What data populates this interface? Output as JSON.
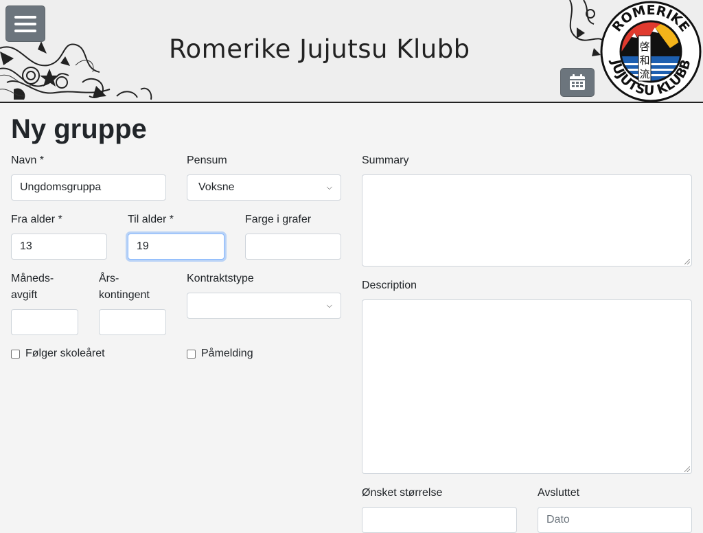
{
  "header": {
    "title": "Romerike Jujutsu Klubb",
    "logo_text_top": "ROMERIKE",
    "logo_text_bottom": "JUJUTSU KLUBB",
    "logo_kanji": [
      "啓",
      "和",
      "流"
    ],
    "menu_icon": "hamburger-icon",
    "calendar_icon": "calendar-icon"
  },
  "form": {
    "title": "Ny gruppe",
    "navn": {
      "label": "Navn *",
      "value": "Ungdomsgruppa"
    },
    "pensum": {
      "label": "Pensum",
      "value": "Voksne"
    },
    "fra_alder": {
      "label": "Fra alder *",
      "value": "13"
    },
    "til_alder": {
      "label": "Til alder *",
      "value": "19"
    },
    "farge": {
      "label": "Farge i grafer",
      "value": ""
    },
    "maanedsavgift": {
      "label_line1": "Måneds-",
      "label_line2": "avgift",
      "value": ""
    },
    "aarskontingent": {
      "label_line1": "Års-",
      "label_line2": "kontingent",
      "value": ""
    },
    "kontraktstype": {
      "label": "Kontraktstype",
      "value": ""
    },
    "folger_skolearet": {
      "label": "Følger skoleåret",
      "checked": false
    },
    "paamelding": {
      "label": "Påmelding",
      "checked": false
    },
    "summary": {
      "label": "Summary",
      "value": ""
    },
    "description": {
      "label": "Description",
      "value": ""
    },
    "onsket_storrelse": {
      "label": "Ønsket størrelse",
      "value": ""
    },
    "avsluttet": {
      "label": "Avsluttet",
      "placeholder": "Dato"
    }
  },
  "colors": {
    "button_gray": "#6c757d",
    "focus_border": "#86b7fe",
    "page_bg": "#f4f4f4"
  }
}
